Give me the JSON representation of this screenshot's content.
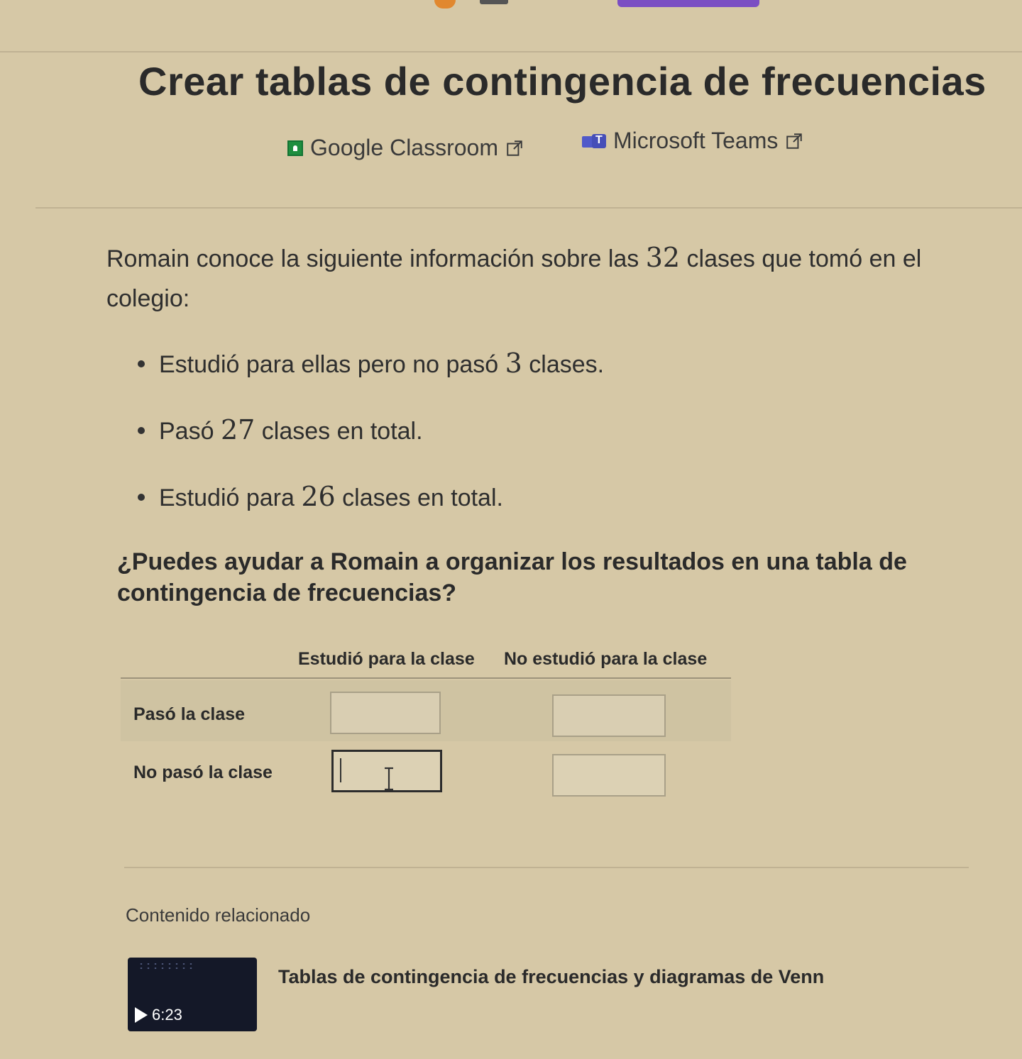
{
  "page": {
    "title": "Crear tablas de contingencia de frecuencias"
  },
  "share": {
    "google_classroom": "Google Classroom",
    "microsoft_teams": "Microsoft Teams"
  },
  "problem": {
    "intro_part1": "Romain conoce la siguiente información sobre las ",
    "intro_num": "32",
    "intro_part2": " clases que tomó en el colegio:",
    "bullets": [
      {
        "pre": "Estudió para ellas pero no pasó ",
        "num": "3",
        "post": " clases."
      },
      {
        "pre": "Pasó ",
        "num": "27",
        "post": " clases en total."
      },
      {
        "pre": "Estudió para ",
        "num": "26",
        "post": " clases en total."
      }
    ],
    "question": "¿Puedes ayudar a Romain a organizar los resultados en una tabla de contingencia de frecuencias?"
  },
  "table": {
    "col_headers": [
      "Estudió para la clase",
      "No estudió para la clase"
    ],
    "row_headers": [
      "Pasó la clase",
      "No pasó la clase"
    ],
    "cells": [
      [
        "",
        ""
      ],
      [
        "",
        ""
      ]
    ]
  },
  "related": {
    "heading": "Contenido relacionado",
    "video_title": "Tablas de contingencia de frecuencias y diagramas de Venn",
    "video_duration": "6:23"
  },
  "colors": {
    "background": "#d6c8a6",
    "text": "#2a2a2a",
    "accent_purple": "#7b4ec3",
    "google_green": "#1e8e3e",
    "teams_purple": "#5059c9"
  }
}
